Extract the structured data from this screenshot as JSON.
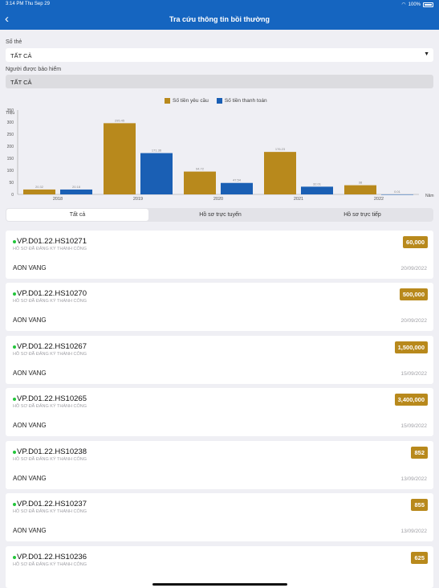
{
  "status_bar": {
    "time": "3:14 PM  Thu Sep 29",
    "battery": "100%"
  },
  "nav": {
    "back_icon": "chevron-left-icon",
    "title": "Tra cứu thông tin bồi thường"
  },
  "form": {
    "card_label": "Số thẻ",
    "card_value": "TẤT CẢ",
    "insured_label": "Người được bảo hiểm",
    "insured_value": "TẤT CẢ"
  },
  "chart_data": {
    "type": "bar",
    "ylabel": "Triệu",
    "xlabel": "Năm",
    "categories": [
      "2018",
      "2019",
      "2020",
      "2021",
      "2022"
    ],
    "ylim": [
      0,
      350
    ],
    "yticks": [
      0,
      50,
      100,
      150,
      200,
      250,
      300,
      350
    ],
    "series": [
      {
        "name": "Số tiền yêu cầu",
        "color": "#b8891c",
        "values": [
          20.32,
          295.45,
          94.72,
          176.23,
          38
        ],
        "labels": [
          "20.32",
          "295.45",
          "94.72",
          "176.23",
          "38"
        ]
      },
      {
        "name": "Số tiền thanh toán",
        "color": "#1a5fb4",
        "values": [
          20.18,
          171.36,
          47.54,
          32.01,
          0.01
        ],
        "labels": [
          "20.18",
          "171.36",
          "47.54",
          "32.01",
          "0.01"
        ]
      }
    ]
  },
  "tabs": [
    {
      "label": "Tất cả",
      "active": true
    },
    {
      "label": "Hồ sơ trực tuyến",
      "active": false
    },
    {
      "label": "Hồ sơ trực tiếp",
      "active": false
    }
  ],
  "claims": [
    {
      "code": "VP.D01.22.HS10271",
      "status": "HỒ SƠ ĐÃ ĐĂNG KÝ THÀNH CÔNG",
      "amount": "60,000",
      "name": "AON VANG",
      "date": "20/09/2022"
    },
    {
      "code": "VP.D01.22.HS10270",
      "status": "HỒ SƠ ĐÃ ĐĂNG KÝ THÀNH CÔNG",
      "amount": "500,000",
      "name": "AON VANG",
      "date": "20/09/2022"
    },
    {
      "code": "VP.D01.22.HS10267",
      "status": "HỒ SƠ ĐÃ ĐĂNG KÝ THÀNH CÔNG",
      "amount": "1,500,000",
      "name": "AON VANG",
      "date": "15/09/2022"
    },
    {
      "code": "VP.D01.22.HS10265",
      "status": "HỒ SƠ ĐÃ ĐĂNG KÝ THÀNH CÔNG",
      "amount": "3,400,000",
      "name": "AON VANG",
      "date": "15/09/2022"
    },
    {
      "code": "VP.D01.22.HS10238",
      "status": "HỒ SƠ ĐÃ ĐĂNG KÝ THÀNH CÔNG",
      "amount": "852",
      "name": "AON VANG",
      "date": "13/09/2022"
    },
    {
      "code": "VP.D01.22.HS10237",
      "status": "HỒ SƠ ĐÃ ĐĂNG KÝ THÀNH CÔNG",
      "amount": "855",
      "name": "AON VANG",
      "date": "13/09/2022"
    },
    {
      "code": "VP.D01.22.HS10236",
      "status": "HỒ SƠ ĐÃ ĐĂNG KÝ THÀNH CÔNG",
      "amount": "625",
      "name": "",
      "date": ""
    }
  ]
}
